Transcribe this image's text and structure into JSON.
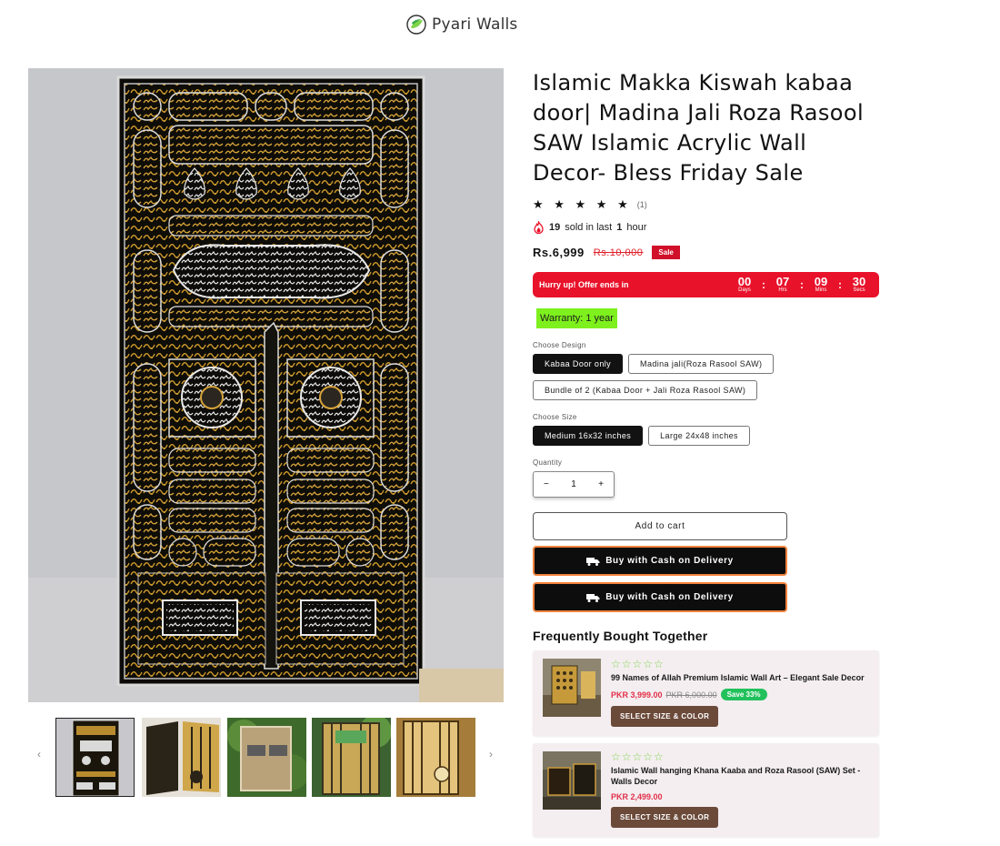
{
  "brand": {
    "name": "Pyari Walls",
    "accent": "#7fd44a"
  },
  "product": {
    "title": "Islamic Makka Kiswah kabaa door| Madina Jali Roza Rasool SAW Islamic Acrylic Wall Decor- Bless Friday Sale",
    "stars": "★ ★ ★ ★ ★",
    "rating_count": "(1)",
    "rating_value": 5,
    "sold_count": "19",
    "sold_pre": "sold in last",
    "sold_hours": "1",
    "sold_post": "hour",
    "price": "Rs.6,999",
    "compare_price": "Rs.10,000",
    "sale_badge": "Sale"
  },
  "countdown": {
    "label": "Hurry up! Offer ends in",
    "days": "00",
    "days_label": "Days",
    "hrs": "07",
    "hrs_label": "Hrs",
    "mins": "09",
    "mins_label": "Mins",
    "secs": "30",
    "secs_label": "Secs",
    "color": "#e8122a"
  },
  "warranty": {
    "text": "Warranty: 1 year",
    "color": "#7ef01e"
  },
  "design": {
    "label": "Choose Design",
    "options": [
      "Kabaa Door only",
      "Madina jali(Roza Rasool SAW)",
      "Bundle of 2 (Kabaa Door + Jali Roza Rasool SAW)"
    ],
    "selected": "Kabaa Door only"
  },
  "size": {
    "label": "Choose Size",
    "options": [
      "Medium 16x32 inches",
      "Large 24x48 inches"
    ],
    "selected": "Medium 16x32 inches"
  },
  "quantity": {
    "label": "Quantity",
    "minus": "−",
    "value": "1",
    "plus": "+"
  },
  "buttons": {
    "add_to_cart": "Add to cart",
    "cod_1": "Buy with Cash on Delivery",
    "cod_2": "Buy with Cash on Delivery",
    "cod_border": "#f2823a"
  },
  "gallery": {
    "prev": "‹",
    "next": "›",
    "thumb_count": 5
  },
  "fbt": {
    "title": "Frequently Bought Together",
    "items": [
      {
        "stars": "☆☆☆☆☆",
        "name": "99 Names of Allah Premium Islamic Wall Art – Elegant Sale Decor",
        "price": "PKR 3,999.00",
        "compare": "PKR 6,000.00",
        "save": "Save 33%",
        "button": "SELECT SIZE & COLOR"
      },
      {
        "stars": "☆☆☆☆☆",
        "name": "Islamic Wall hanging Khana Kaaba and Roza Rasool (SAW) Set - Walls Decor",
        "price": "PKR 2,499.00",
        "button": "SELECT SIZE & COLOR"
      }
    ]
  }
}
